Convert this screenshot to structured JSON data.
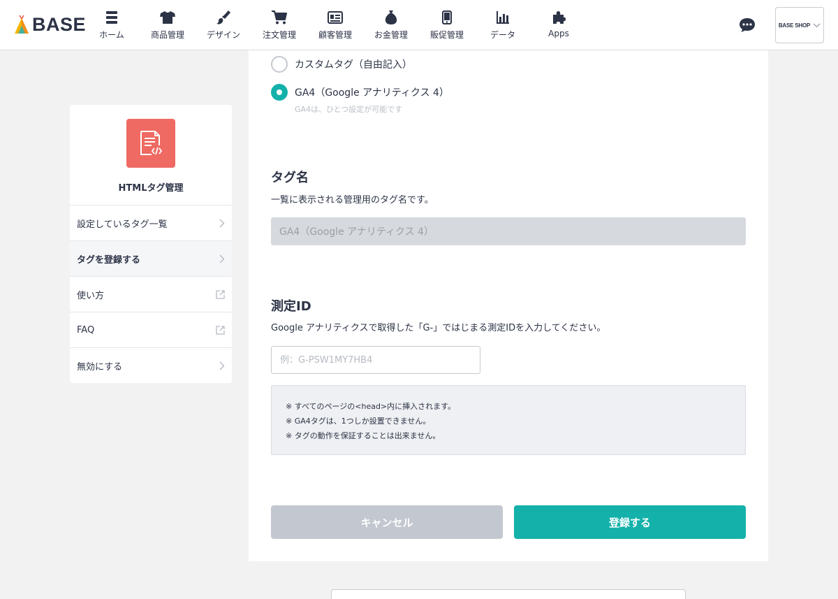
{
  "header": {
    "logo_text": "BASE",
    "nav": [
      {
        "label": "ホーム",
        "icon": "home-icon"
      },
      {
        "label": "商品管理",
        "icon": "tshirt-icon"
      },
      {
        "label": "デザイン",
        "icon": "brush-icon"
      },
      {
        "label": "注文管理",
        "icon": "cart-icon"
      },
      {
        "label": "顧客管理",
        "icon": "id-card-icon"
      },
      {
        "label": "お金管理",
        "icon": "money-bag-icon"
      },
      {
        "label": "販促管理",
        "icon": "smartphone-icon"
      },
      {
        "label": "データ",
        "icon": "bar-chart-icon"
      },
      {
        "label": "Apps",
        "icon": "puzzle-icon"
      }
    ],
    "shop_label": "BASE SHOP"
  },
  "sidebar": {
    "app_title": "HTMLタグ管理",
    "items": [
      {
        "label": "設定しているタグ一覧",
        "icon": "chevron-right-icon"
      },
      {
        "label": "タグを登録する",
        "icon": "chevron-right-icon"
      },
      {
        "label": "使い方",
        "icon": "external-link-icon"
      },
      {
        "label": "FAQ",
        "icon": "external-link-icon"
      },
      {
        "label": "無効にする",
        "icon": "chevron-right-icon"
      }
    ]
  },
  "form": {
    "radio_custom_label": "カスタムタグ（自由記入）",
    "radio_ga4_label": "GA4（Google アナリティクス 4）",
    "radio_ga4_note": "GA4は、ひとつ設定が可能です",
    "selected_option": "GA4",
    "tag_name_title": "タグ名",
    "tag_name_desc": "一覧に表示される管理用のタグ名です。",
    "tag_name_value": "GA4（Google アナリティクス 4）",
    "measure_title": "測定ID",
    "measure_desc": "Google アナリティクスで取得した「G-」ではじまる測定IDを入力してください。",
    "measure_placeholder": "例：G-PSW1MY7HB4",
    "notes": [
      "※ すべてのページの<head>内に挿入されます。",
      "※ GA4タグは、1つしか設置できません。",
      "※ タグの動作を保証することは出来ません。"
    ],
    "cancel_label": "キャンセル",
    "submit_label": "登録する"
  },
  "colors": {
    "accent": "#14b1aa",
    "app_icon": "#ee6a62",
    "text": "#2c3346"
  }
}
